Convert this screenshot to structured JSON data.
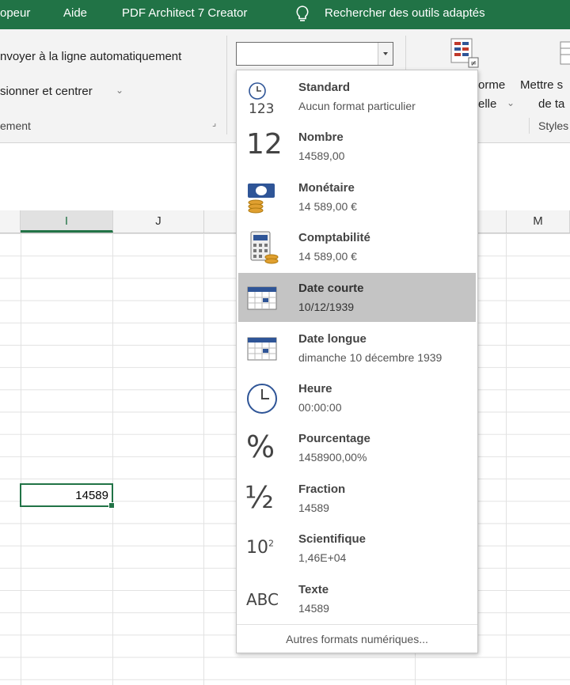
{
  "ribbon_tabs": [
    "opeur",
    "Aide",
    "PDF Architect 7 Creator",
    "Rechercher des outils adaptés"
  ],
  "alignment_group": {
    "wrap_text": "nvoyer à la ligne automatiquement",
    "merge_center": "sionner et centrer",
    "group_label": "ement"
  },
  "number_format_combo": {
    "value": ""
  },
  "styles_group": {
    "conditional_line1": "orme",
    "conditional_line2": "elle",
    "table_line1": "Mettre s",
    "table_line2": "de ta",
    "group_label": "Styles"
  },
  "columns": [
    "I",
    "J",
    "M"
  ],
  "active_cell_value": "14589",
  "formats": [
    {
      "name": "Standard",
      "sample": "Aucun format particulier",
      "icon": "clock-123-icon"
    },
    {
      "name": "Nombre",
      "sample": "14589,00",
      "icon": "number-12-icon",
      "glyph": "12"
    },
    {
      "name": "Monétaire",
      "sample": "14 589,00 €",
      "icon": "currency-icon"
    },
    {
      "name": "Comptabilité",
      "sample": " 14 589,00 €",
      "icon": "accounting-icon"
    },
    {
      "name": "Date courte",
      "sample": "10/12/1939",
      "icon": "calendar-short-icon"
    },
    {
      "name": "Date longue",
      "sample": "dimanche 10 décembre 1939",
      "icon": "calendar-long-icon"
    },
    {
      "name": "Heure",
      "sample": "00:00:00",
      "icon": "clock-icon"
    },
    {
      "name": "Pourcentage",
      "sample": "1458900,00%",
      "icon": "percent-icon",
      "glyph": "%"
    },
    {
      "name": "Fraction",
      "sample": "14589",
      "icon": "fraction-icon",
      "glyph": "½"
    },
    {
      "name": "Scientifique",
      "sample": "1,46E+04",
      "icon": "scientific-icon",
      "glyph": "10",
      "glyph_sup": "2"
    },
    {
      "name": "Texte",
      "sample": "14589",
      "icon": "text-abc-icon",
      "glyph": "ABC"
    }
  ],
  "selected_format": "Date courte",
  "more_formats": "Autres formats numériques...",
  "colors": {
    "excel_green": "#217346",
    "selection": "#c4c4c4"
  }
}
